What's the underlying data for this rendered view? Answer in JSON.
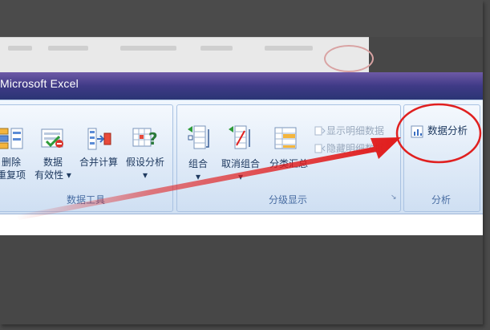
{
  "window": {
    "title": "Microsoft Excel"
  },
  "ribbon": {
    "groups": [
      {
        "label": "数据工具",
        "buttons": [
          {
            "label_line1": "删除",
            "label_line2": "重复项"
          },
          {
            "label_line1": "数据",
            "label_line2": "有效性 ▾"
          },
          {
            "label_line1": "合并计算"
          },
          {
            "label_line1": "假设分析",
            "label_line2": "▾"
          }
        ]
      },
      {
        "label": "分级显示",
        "buttons": [
          {
            "label_line1": "组合",
            "label_line2": "▾"
          },
          {
            "label_line1": "取消组合",
            "label_line2": "▾"
          },
          {
            "label_line1": "分类汇总"
          }
        ],
        "small_items": [
          {
            "label": "显示明细数据"
          },
          {
            "label": "隐藏明细数据"
          }
        ]
      },
      {
        "label": "分析",
        "buttons": [
          {
            "label_line1": "数据分析"
          }
        ]
      }
    ]
  },
  "colors": {
    "title_bar": "#3f3a86",
    "ribbon": "#dde9f7",
    "highlight": "#e02020",
    "arrow": "#e11b1b",
    "group_label": "#4a6ea3"
  }
}
